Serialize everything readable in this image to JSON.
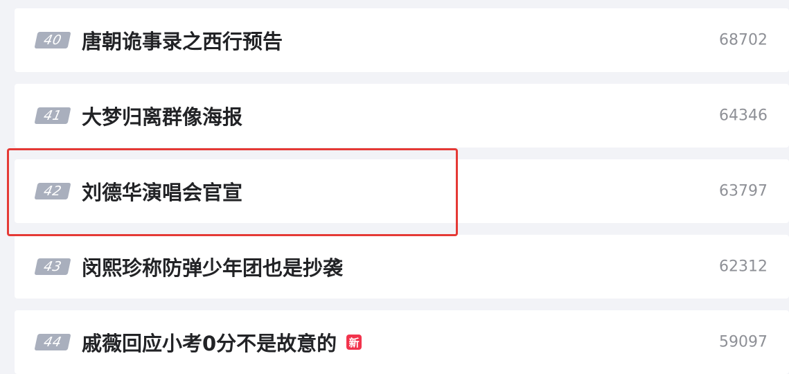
{
  "hot_list": {
    "items": [
      {
        "rank": "40",
        "title": "唐朝诡事录之西行预告",
        "count": "68702",
        "badge": ""
      },
      {
        "rank": "41",
        "title": "大梦归离群像海报",
        "count": "64346",
        "badge": ""
      },
      {
        "rank": "42",
        "title": "刘德华演唱会官宣",
        "count": "63797",
        "badge": ""
      },
      {
        "rank": "43",
        "title": "闵熙珍称防弹少年团也是抄袭",
        "count": "62312",
        "badge": ""
      },
      {
        "rank": "44",
        "title": "戚薇回应小考0分不是故意的",
        "count": "59097",
        "badge": "新"
      }
    ]
  },
  "colors": {
    "background": "#f2f3f7",
    "row_background": "#ffffff",
    "rank_badge": "#a9afbd",
    "title_text": "#222326",
    "count_text": "#8e9096",
    "new_badge": "#f2334c",
    "highlight_border": "#e53935"
  }
}
